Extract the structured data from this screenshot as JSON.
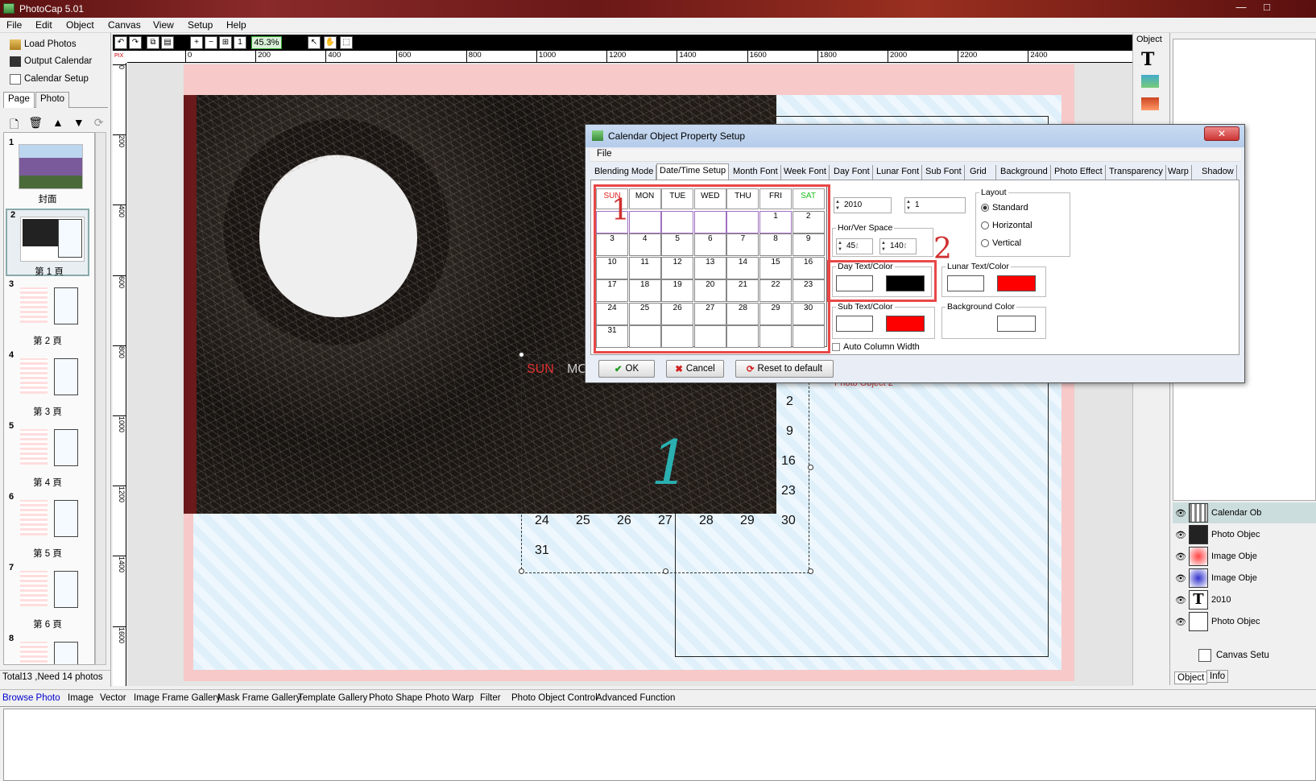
{
  "app": {
    "title": "PhotoCap 5.01"
  },
  "menu": [
    "File",
    "Edit",
    "Object",
    "Canvas",
    "View",
    "Setup",
    "Help"
  ],
  "left": {
    "buttons": [
      "Load Photos",
      "Output Calendar",
      "Calendar Setup"
    ],
    "tabs": [
      "Page",
      "Photo"
    ],
    "thumbs": [
      {
        "num": "1",
        "label": "封面"
      },
      {
        "num": "2",
        "label": "第 1 頁"
      },
      {
        "num": "3",
        "label": "第 2 頁"
      },
      {
        "num": "4",
        "label": "第 3 頁"
      },
      {
        "num": "5",
        "label": "第 4 頁"
      },
      {
        "num": "6",
        "label": "第 5 頁"
      },
      {
        "num": "7",
        "label": "第 6 頁"
      },
      {
        "num": "8",
        "label": ""
      }
    ],
    "status": "Total13 ,Need 14 photos"
  },
  "toolbar": {
    "zoom": "45.3%"
  },
  "ruler": {
    "top": [
      "0",
      "200",
      "400",
      "600",
      "800",
      "1000",
      "1200",
      "1400",
      "1600",
      "1800",
      "2000",
      "2200",
      "2400"
    ],
    "left": [
      "0",
      "200",
      "400",
      "600",
      "800",
      "1000",
      "1200",
      "1400",
      "1600"
    ],
    "unit": "PIX"
  },
  "canvas": {
    "cal_head": [
      "SUN",
      "MO"
    ],
    "days": [
      "2",
      "9",
      "16",
      "23",
      "24",
      "25",
      "26",
      "27",
      "28",
      "29",
      "30",
      "31"
    ],
    "big_month": "1",
    "photo_label": "Photo Object 2"
  },
  "right": {
    "object_label": "Object",
    "layers": [
      "Calendar Ob",
      "Photo Objec",
      "Image Obje",
      "Image Obje",
      "2010",
      "Photo Objec"
    ],
    "canvas_setup": "Canvas Setu",
    "tabs": [
      "Object",
      "Info"
    ]
  },
  "bottom_tabs": [
    "Browse Photo",
    "Image",
    "Vector",
    "Image Frame Gallery",
    "Mask Frame Gallery",
    "Template Gallery",
    "Photo Shape",
    "Photo Warp",
    "Filter",
    "Photo Object Control",
    "Advanced Function"
  ],
  "dialog": {
    "title": "Calendar Object Property Setup",
    "menu": "File",
    "tabs": [
      "Blending Mode",
      "Date/Time Setup",
      "Month Font",
      "Week Font",
      "Day Font",
      "Lunar Font",
      "Sub Font",
      "Grid",
      "Background",
      "Photo Effect",
      "Transparency",
      "Warp",
      "Shadow"
    ],
    "weekdays": [
      "SUN",
      "MON",
      "TUE",
      "WED",
      "THU",
      "FRI",
      "SAT"
    ],
    "weeks": [
      [
        "",
        "",
        "",
        "",
        "",
        "1",
        "2"
      ],
      [
        "3",
        "4",
        "5",
        "6",
        "7",
        "8",
        "9"
      ],
      [
        "10",
        "11",
        "12",
        "13",
        "14",
        "15",
        "16"
      ],
      [
        "17",
        "18",
        "19",
        "20",
        "21",
        "22",
        "23"
      ],
      [
        "24",
        "25",
        "26",
        "27",
        "28",
        "29",
        "30"
      ],
      [
        "31",
        "",
        "",
        "",
        "",
        "",
        ""
      ]
    ],
    "year": "2010",
    "month": "1",
    "hv_label": "Hor/Ver Space",
    "hspace": "45",
    "vspace": "140",
    "layout_label": "Layout",
    "layouts": [
      "Standard",
      "Horizontal",
      "Vertical"
    ],
    "day_color_label": "Day Text/Color",
    "lunar_color_label": "Lunar Text/Color",
    "sub_color_label": "Sub Text/Color",
    "bg_color_label": "Background Color",
    "auto_col": "Auto Column Width",
    "ok": "OK",
    "cancel": "Cancel",
    "reset": "Reset to default",
    "annot1": "1",
    "annot2": "2",
    "colors": {
      "day": "#000000",
      "lunar": "#ff0000",
      "sub": "#ff0000",
      "bg": "#ffffff",
      "sun": "#e02020",
      "sat": "#20c020"
    }
  }
}
